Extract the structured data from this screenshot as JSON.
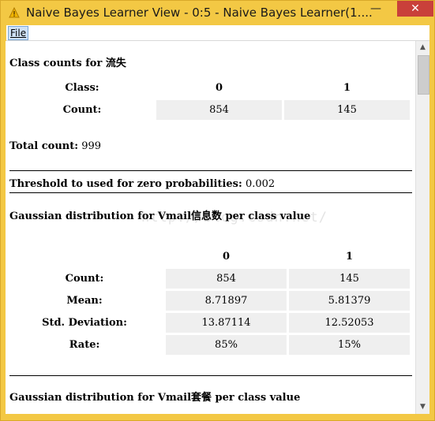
{
  "window": {
    "title": "Naive Bayes Learner View - 0:5 - Naive Bayes Learner(1....",
    "min_glyph": "—",
    "max_glyph": "☐",
    "close_glyph": "✕"
  },
  "menu": {
    "file_label": "File"
  },
  "class_counts": {
    "heading": "Class counts for 流失",
    "class_label": "Class:",
    "count_label": "Count:",
    "classes": [
      "0",
      "1"
    ],
    "counts": [
      "854",
      "145"
    ]
  },
  "total_count": {
    "label": "Total count:",
    "value": "999"
  },
  "threshold": {
    "label": "Threshold to used for zero probabilities:",
    "value": "0.002"
  },
  "gaussian1": {
    "heading": "Gaussian distribution for Vmail信息数 per class value",
    "classes": [
      "0",
      "1"
    ],
    "rows": [
      {
        "label": "Count:",
        "values": [
          "854",
          "145"
        ]
      },
      {
        "label": "Mean:",
        "values": [
          "8.71897",
          "5.81379"
        ]
      },
      {
        "label": "Std. Deviation:",
        "values": [
          "13.87114",
          "12.52053"
        ]
      },
      {
        "label": "Rate:",
        "values": [
          "85%",
          "15%"
        ]
      }
    ]
  },
  "gaussian2": {
    "heading": "Gaussian distribution for Vmail套餐 per class value"
  },
  "watermark": "http://blog.csdn.net/",
  "icons": {
    "app": "knime-warning-icon",
    "scroll_up": "scroll-up-arrow-icon",
    "scroll_down": "scroll-down-arrow-icon"
  }
}
